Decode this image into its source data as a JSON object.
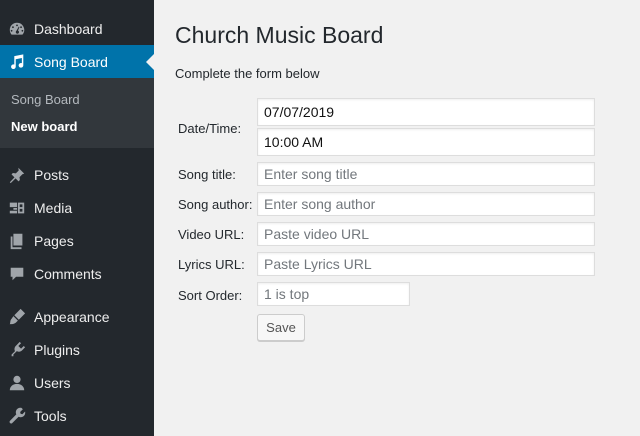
{
  "sidebar": {
    "items": [
      {
        "label": "Dashboard",
        "icon": "dashboard-icon"
      },
      {
        "label": "Song Board",
        "icon": "music-note-icon",
        "active": true
      },
      {
        "label": "Posts",
        "icon": "pushpin-icon"
      },
      {
        "label": "Media",
        "icon": "media-icon"
      },
      {
        "label": "Pages",
        "icon": "pages-icon"
      },
      {
        "label": "Comments",
        "icon": "comments-icon"
      },
      {
        "label": "Appearance",
        "icon": "paintbrush-icon"
      },
      {
        "label": "Plugins",
        "icon": "plugin-icon"
      },
      {
        "label": "Users",
        "icon": "user-icon"
      },
      {
        "label": "Tools",
        "icon": "wrench-icon"
      }
    ],
    "submenu": [
      {
        "label": "Song Board"
      },
      {
        "label": "New board",
        "current": true
      }
    ],
    "active_color": "#0073aa"
  },
  "main": {
    "title": "Church Music Board",
    "description": "Complete the form below",
    "form": {
      "datetime_label": "Date/Time:",
      "date_value": "07/07/2019",
      "time_value": "10:00 AM",
      "song_title_label": "Song title:",
      "song_title_placeholder": "Enter song title",
      "song_author_label": "Song author:",
      "song_author_placeholder": "Enter song author",
      "video_url_label": "Video URL:",
      "video_url_placeholder": "Paste video URL",
      "lyrics_url_label": "Lyrics URL:",
      "lyrics_url_placeholder": "Paste Lyrics URL",
      "sort_order_label": "Sort Order:",
      "sort_order_placeholder": "1 is top",
      "save_label": "Save"
    }
  }
}
